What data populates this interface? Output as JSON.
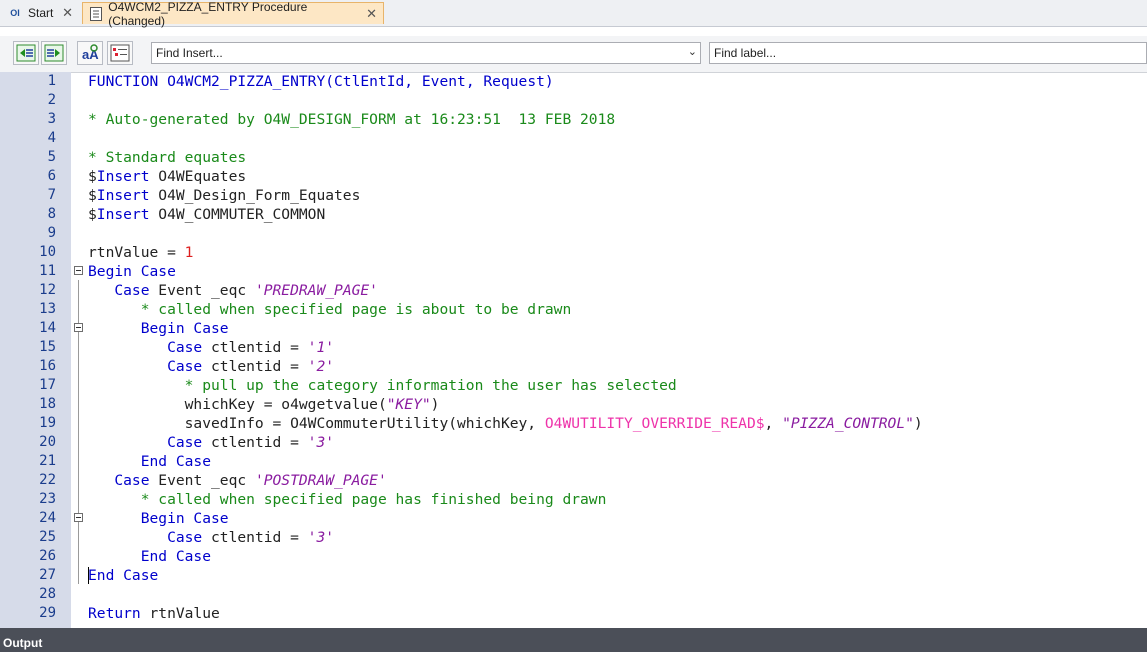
{
  "tabs": [
    {
      "label": "Start",
      "icon": "app-icon"
    },
    {
      "label": "O4WCM2_PIZZA_ENTRY Procedure (Changed)",
      "icon": "document-icon",
      "active": true
    }
  ],
  "tab_close": "✕",
  "toolbar": {
    "find_insert_placeholder": "Find Insert...",
    "find_label_placeholder": "Find label..."
  },
  "editor": {
    "line_numbers": [
      "1",
      "2",
      "3",
      "4",
      "5",
      "6",
      "7",
      "8",
      "9",
      "10",
      "11",
      "12",
      "13",
      "14",
      "15",
      "16",
      "17",
      "18",
      "19",
      "20",
      "21",
      "22",
      "23",
      "24",
      "25",
      "26",
      "27",
      "28",
      "29"
    ],
    "lines": [
      [
        {
          "t": "FUNCTION",
          "c": "kw"
        },
        {
          "t": " O4WCM2_PIZZA_ENTRY(CtlEntId, Event, Request)",
          "c": "kw"
        }
      ],
      [],
      [
        {
          "t": "* Auto-generated by O4W_DESIGN_FORM at 16:23:51  13 FEB 2018",
          "c": "cm"
        }
      ],
      [],
      [
        {
          "t": "* Standard equates",
          "c": "cm"
        }
      ],
      [
        {
          "t": "$",
          "c": "tx"
        },
        {
          "t": "Insert",
          "c": "kw"
        },
        {
          "t": " O4WEquates",
          "c": "tx"
        }
      ],
      [
        {
          "t": "$",
          "c": "tx"
        },
        {
          "t": "Insert",
          "c": "kw"
        },
        {
          "t": " O4W_Design_Form_Equates",
          "c": "tx"
        }
      ],
      [
        {
          "t": "$",
          "c": "tx"
        },
        {
          "t": "Insert",
          "c": "kw"
        },
        {
          "t": " O4W_COMMUTER_COMMON",
          "c": "tx"
        }
      ],
      [],
      [
        {
          "t": "rtnValue = ",
          "c": "tx"
        },
        {
          "t": "1",
          "c": "nm"
        }
      ],
      [
        {
          "t": "Begin Case",
          "c": "kw"
        }
      ],
      [
        {
          "t": "   ",
          "c": "tx"
        },
        {
          "t": "Case",
          "c": "kw"
        },
        {
          "t": " Event _eqc ",
          "c": "tx"
        },
        {
          "t": "'PREDRAW_PAGE'",
          "c": "st"
        }
      ],
      [
        {
          "t": "      * called when specified page is about to be drawn",
          "c": "cm"
        }
      ],
      [
        {
          "t": "      ",
          "c": "tx"
        },
        {
          "t": "Begin Case",
          "c": "kw"
        }
      ],
      [
        {
          "t": "         ",
          "c": "tx"
        },
        {
          "t": "Case",
          "c": "kw"
        },
        {
          "t": " ctlentid = ",
          "c": "tx"
        },
        {
          "t": "'1'",
          "c": "st"
        }
      ],
      [
        {
          "t": "         ",
          "c": "tx"
        },
        {
          "t": "Case",
          "c": "kw"
        },
        {
          "t": " ctlentid = ",
          "c": "tx"
        },
        {
          "t": "'2'",
          "c": "st"
        }
      ],
      [
        {
          "t": "           * pull up the category information the user has selected",
          "c": "cm"
        }
      ],
      [
        {
          "t": "           whichKey = o4wgetvalue(",
          "c": "tx"
        },
        {
          "t": "\"KEY\"",
          "c": "st"
        },
        {
          "t": ")",
          "c": "tx"
        }
      ],
      [
        {
          "t": "           savedInfo = O4WCommuterUtility(whichKey, ",
          "c": "tx"
        },
        {
          "t": "O4WUTILITY_OVERRIDE_READ$",
          "c": "co"
        },
        {
          "t": ", ",
          "c": "tx"
        },
        {
          "t": "\"PIZZA_CONTROL\"",
          "c": "st"
        },
        {
          "t": ")",
          "c": "tx"
        }
      ],
      [
        {
          "t": "         ",
          "c": "tx"
        },
        {
          "t": "Case",
          "c": "kw"
        },
        {
          "t": " ctlentid = ",
          "c": "tx"
        },
        {
          "t": "'3'",
          "c": "st"
        }
      ],
      [
        {
          "t": "      ",
          "c": "tx"
        },
        {
          "t": "End Case",
          "c": "kw"
        }
      ],
      [
        {
          "t": "   ",
          "c": "tx"
        },
        {
          "t": "Case",
          "c": "kw"
        },
        {
          "t": " Event _eqc ",
          "c": "tx"
        },
        {
          "t": "'POSTDRAW_PAGE'",
          "c": "st"
        }
      ],
      [
        {
          "t": "      * called when specified page has finished being drawn",
          "c": "cm"
        }
      ],
      [
        {
          "t": "      ",
          "c": "tx"
        },
        {
          "t": "Begin Case",
          "c": "kw"
        }
      ],
      [
        {
          "t": "         ",
          "c": "tx"
        },
        {
          "t": "Case",
          "c": "kw"
        },
        {
          "t": " ctlentid = ",
          "c": "tx"
        },
        {
          "t": "'3'",
          "c": "st"
        }
      ],
      [
        {
          "t": "      ",
          "c": "tx"
        },
        {
          "t": "End Case",
          "c": "kw"
        }
      ],
      [
        {
          "t": "End Case",
          "c": "kw"
        }
      ],
      [],
      [
        {
          "t": "Return",
          "c": "kw"
        },
        {
          "t": " rtnValue",
          "c": "tx"
        }
      ]
    ]
  },
  "output_panel": {
    "label": "Output"
  },
  "colors": {
    "keyword": "#0000cc",
    "comment": "#1a8a1a",
    "string": "#8a1ca0",
    "number": "#dd1f1f",
    "constant": "#ee33aa",
    "gutter": "#d6dbe9",
    "active_tab": "#fde7c5"
  }
}
